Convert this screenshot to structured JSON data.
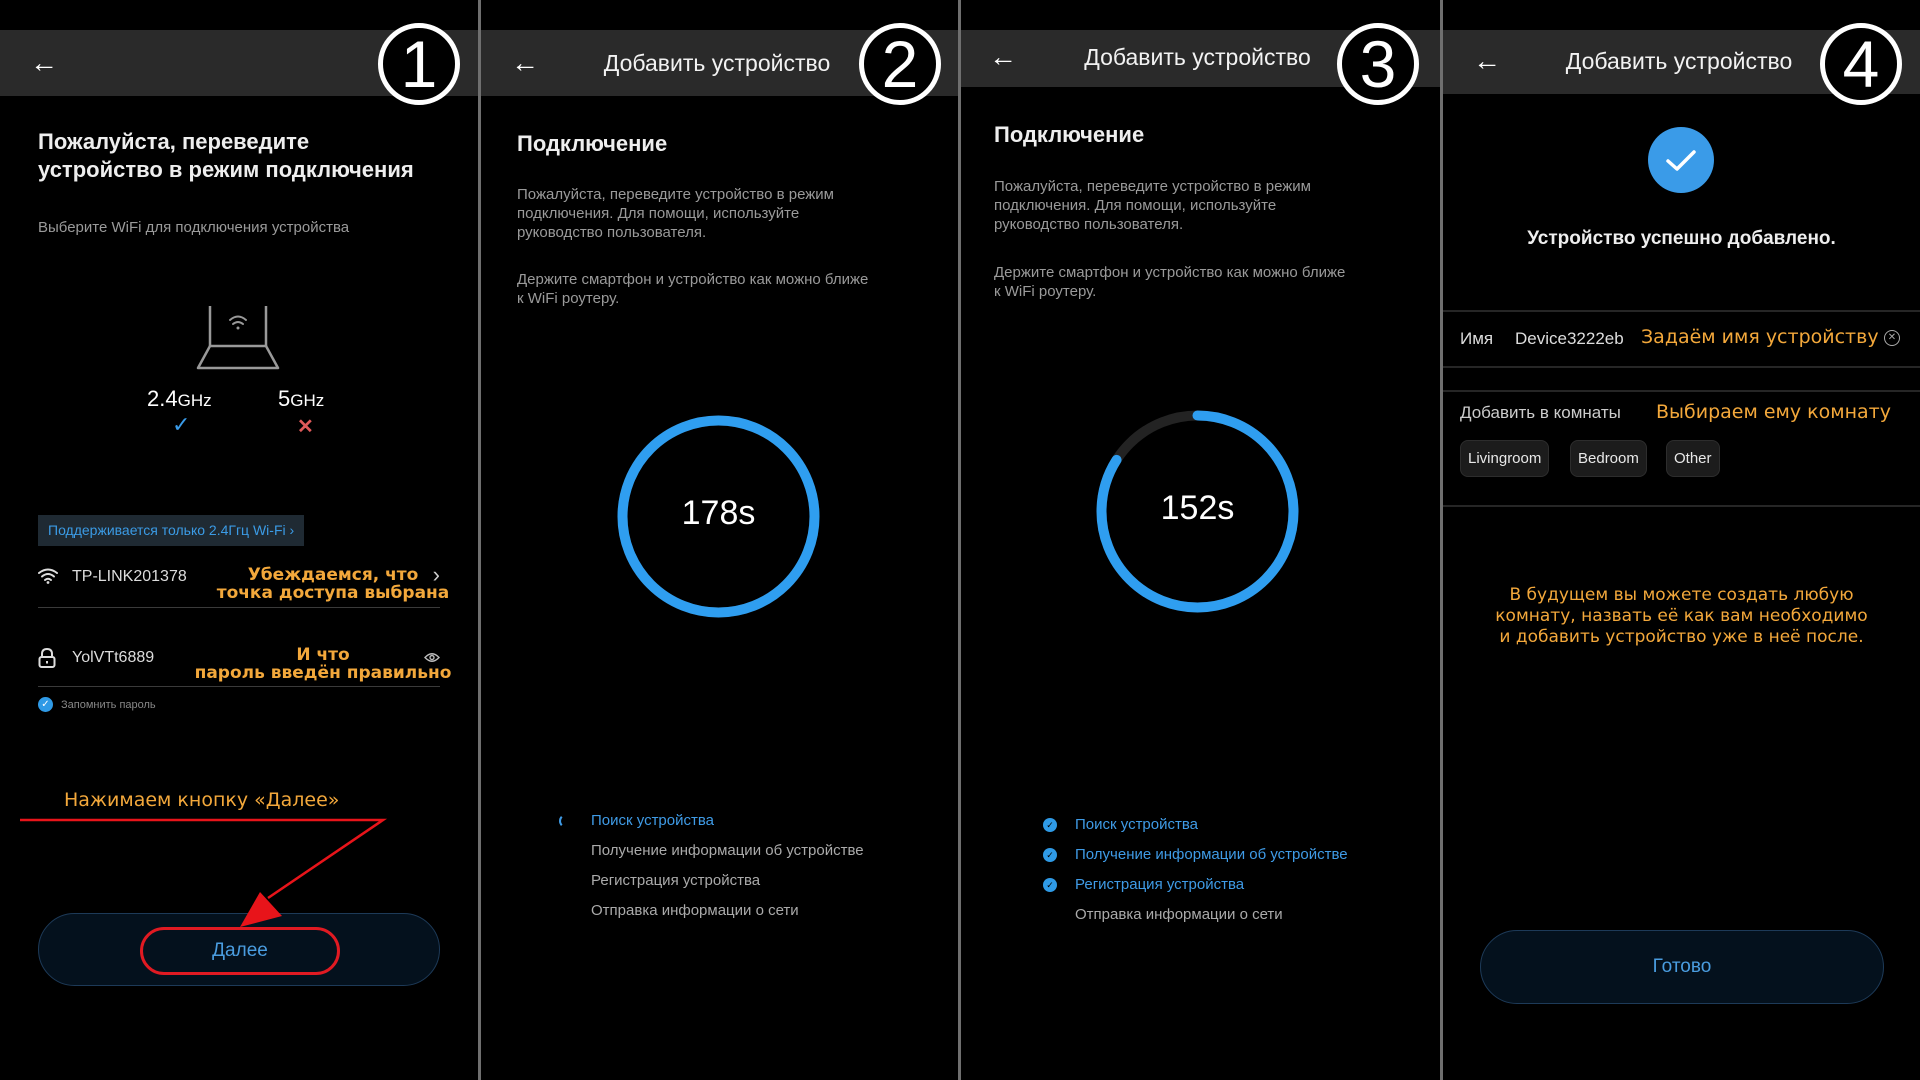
{
  "colors": {
    "accent_blue": "#3a9be8",
    "annotation_orange": "#f3a83b",
    "annotation_red": "#e8141a",
    "error_red": "#e05a5a",
    "appbar": "#2a2a2a"
  },
  "panels": [
    {
      "step": "1",
      "appbar": {
        "back_icon": "arrow-left-icon",
        "title": ""
      },
      "heading": "Пожалуйста, переведите устройство в режим подключения",
      "heading_lines": [
        "Пожалуйста, переведите",
        "устройство в режим подключения"
      ],
      "subtitle": "Выберите WiFi для подключения устройства",
      "bands": [
        {
          "label": "2.4",
          "unit": "GHz",
          "supported": true,
          "status_icon": "check-icon"
        },
        {
          "label": "5",
          "unit": "GHz",
          "supported": false,
          "status_icon": "cross-icon"
        }
      ],
      "support_note": "Поддерживается только 2.4Ггц Wi-Fi",
      "wifi": {
        "icon": "wifi-icon",
        "ssid": "TP-LINK201378",
        "annotation_lines": [
          "Убеждаемся, что",
          "точка доступа выбрана"
        ]
      },
      "password": {
        "icon": "lock-icon",
        "value": "YolVTt6889",
        "annotation_lines": [
          "И что",
          "пароль введён правильно"
        ],
        "toggle_icon": "eye-icon"
      },
      "remember_password": {
        "label": "Запомнить пароль",
        "checked": true
      },
      "annotation_next": "Нажимаем кнопку «Далее»",
      "next_button": "Далее"
    },
    {
      "step": "2",
      "appbar": {
        "back_icon": "arrow-left-icon",
        "title": "Добавить устройство"
      },
      "heading": "Подключение",
      "desc_lines": [
        "Пожалуйста, переведите устройство в режим",
        "подключения. Для помощи, используйте",
        "руководство пользователя."
      ],
      "hint_lines": [
        "Держите смартфон и устройство как можно ближе",
        "к WiFi роутеру."
      ],
      "countdown": "178s",
      "progress_remaining": 1.0,
      "steps": [
        {
          "label": "Поиск устройства",
          "state": "in-progress"
        },
        {
          "label": "Получение информации об устройстве",
          "state": "pending"
        },
        {
          "label": "Регистрация устройства",
          "state": "pending"
        },
        {
          "label": "Отправка информации о сети",
          "state": "pending"
        }
      ]
    },
    {
      "step": "3",
      "appbar": {
        "back_icon": "arrow-left-icon",
        "title": "Добавить устройство"
      },
      "heading": "Подключение",
      "desc_lines": [
        "Пожалуйста, переведите устройство в режим",
        "подключения. Для помощи, используйте",
        "руководство пользователя."
      ],
      "hint_lines": [
        "Держите смартфон и устройство как можно ближе",
        "к WiFi роутеру."
      ],
      "countdown": "152s",
      "progress_remaining": 0.84,
      "steps": [
        {
          "label": "Поиск устройства",
          "state": "done"
        },
        {
          "label": "Получение информации об устройстве",
          "state": "done"
        },
        {
          "label": "Регистрация устройства",
          "state": "done"
        },
        {
          "label": "Отправка информации о сети",
          "state": "pending"
        }
      ]
    },
    {
      "step": "4",
      "appbar": {
        "back_icon": "arrow-left-icon",
        "title": "Добавить устройство"
      },
      "success_icon": "check-circle-icon",
      "success_text": "Устройство успешно добавлено.",
      "name": {
        "label": "Имя",
        "value": "Device3222eb",
        "annotation": "Задаём имя устройству",
        "clear_icon": "clear-icon"
      },
      "rooms": {
        "label": "Добавить в комнаты",
        "annotation": "Выбираем ему комнату",
        "options": [
          "Livingroom",
          "Bedroom",
          "Other"
        ]
      },
      "note_lines": [
        "В будущем вы можете создать любую",
        "комнату, назвать её как вам необходимо",
        "и добавить устройство уже в неё после."
      ],
      "done_button": "Готово"
    }
  ]
}
